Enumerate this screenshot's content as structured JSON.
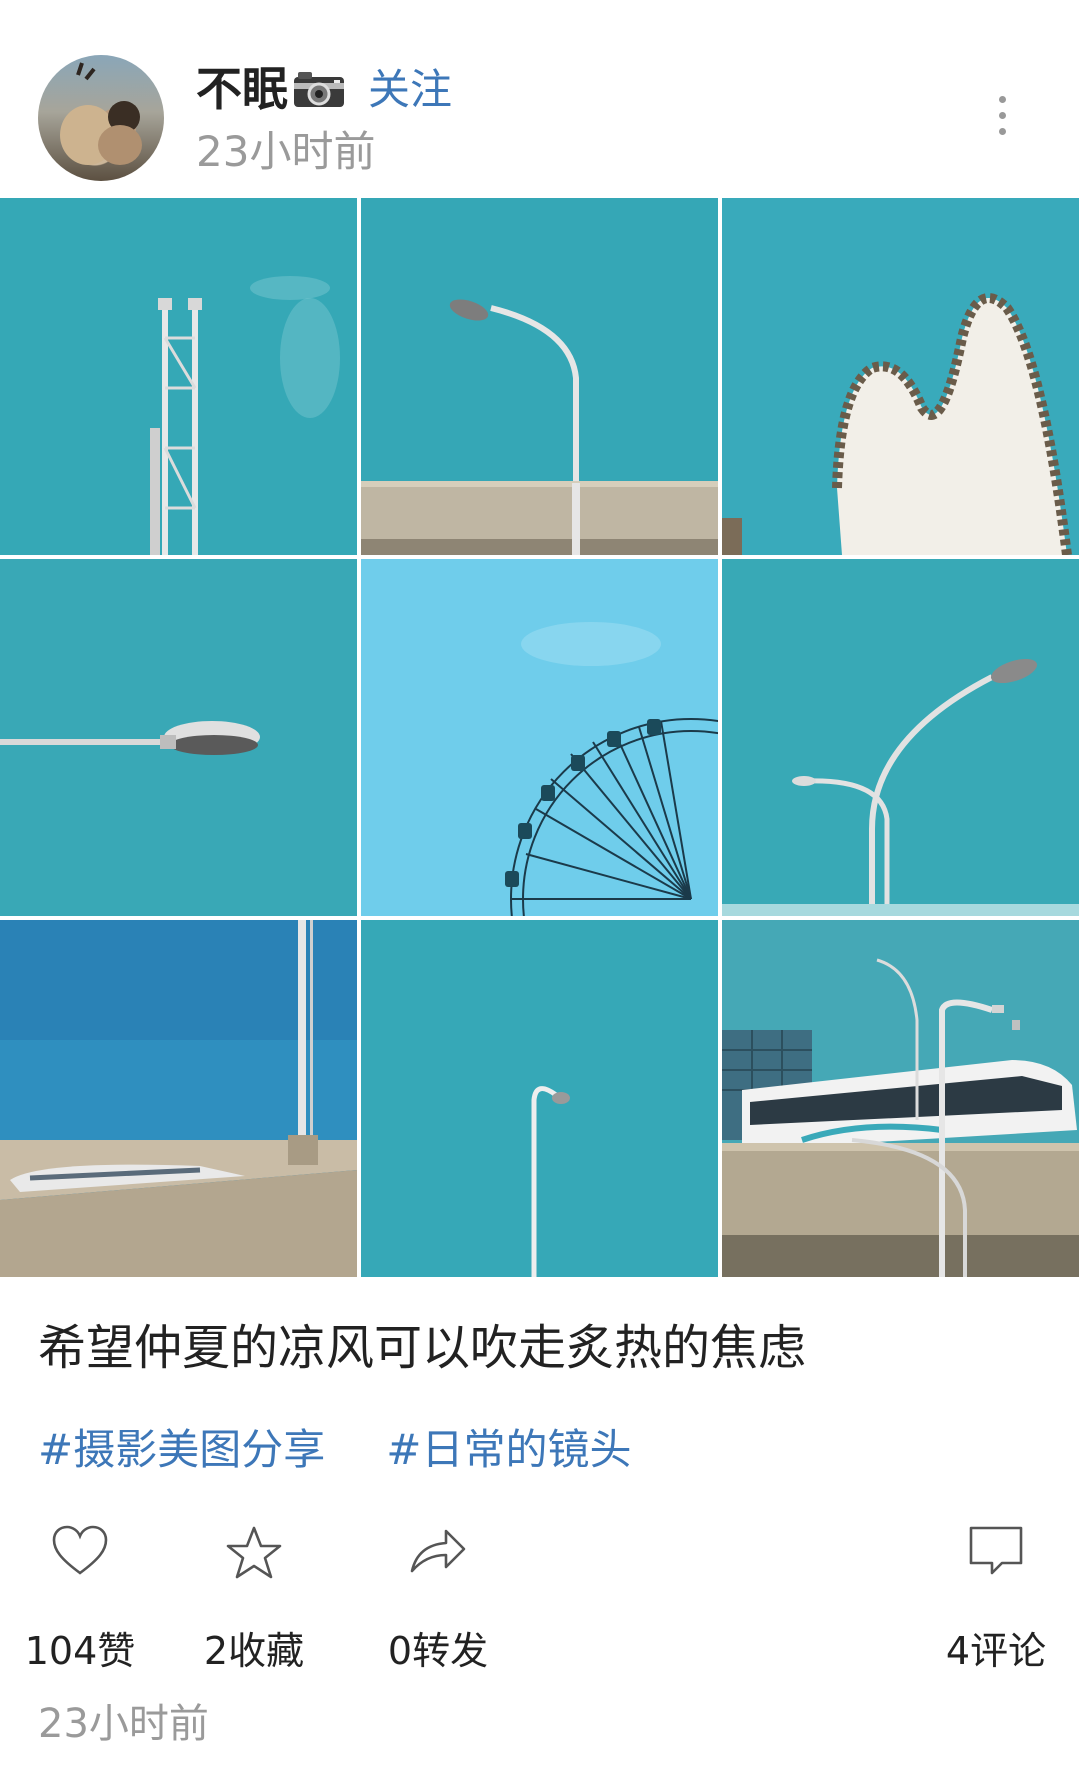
{
  "post": {
    "username": "不眠",
    "username_emoji": "camera-icon",
    "follow_label": "关注",
    "time": "23小时前",
    "caption": "希望仲夏的凉风可以吹走炙热的焦虑",
    "tags": [
      "#摄影美图分享",
      "#日常的镜头"
    ],
    "footer_time": "23小时前"
  },
  "actions": {
    "like": {
      "icon": "heart-icon",
      "label": "104赞"
    },
    "favorite": {
      "icon": "star-icon",
      "label": "2收藏"
    },
    "share": {
      "icon": "share-arrow-icon",
      "label": "0转发"
    },
    "comment": {
      "icon": "comment-icon",
      "label": "4评论"
    }
  },
  "photos": [
    "steel-tower",
    "street-lamp-on-bridge",
    "curved-building-roof",
    "street-lamp-head",
    "ferris-wheel",
    "double-street-lamp",
    "pole-and-van-on-overpass",
    "single-lamp-post",
    "bus-on-overpass"
  ],
  "colors": {
    "link": "#3d77b8",
    "muted": "#9a9a9a",
    "sky": "#34a6b4"
  }
}
